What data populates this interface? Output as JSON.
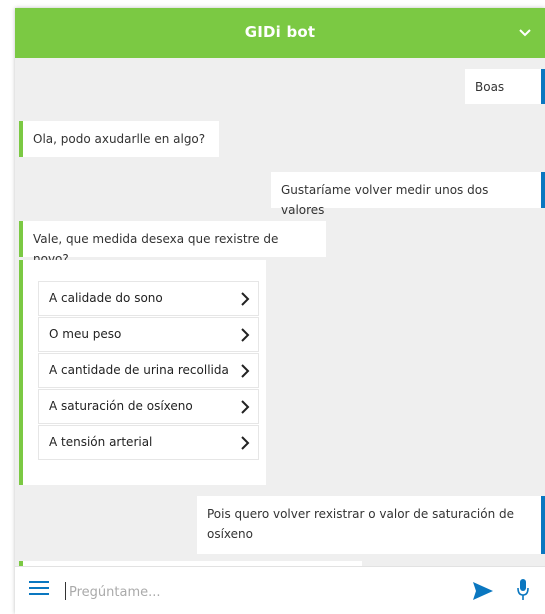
{
  "header": {
    "title": "GIDi bot"
  },
  "messages": [
    {
      "from": "user",
      "text": "Boas"
    },
    {
      "from": "bot",
      "text": "Ola, podo axudarlle en algo?"
    },
    {
      "from": "user",
      "text": "Gustaríame volver medir unos dos valores"
    },
    {
      "from": "bot",
      "text": "Vale, que medida desexa que rexistre de novo?"
    },
    {
      "from": "user",
      "text": "Pois quero volver rexistrar o valor de saturación de osíxeno"
    }
  ],
  "options": [
    {
      "label": "A calidade do sono"
    },
    {
      "label": "O meu peso"
    },
    {
      "label": "A cantidade de urina recollida"
    },
    {
      "label": "A saturación de osíxeno"
    },
    {
      "label": "A tensión arterial"
    }
  ],
  "input": {
    "placeholder": "Pregúntame...",
    "value": ""
  },
  "colors": {
    "brand_green": "#7bc943",
    "accent_blue": "#0a77c0"
  },
  "icons": [
    "chevron-down-icon",
    "chevron-right-icon",
    "menu-icon",
    "send-icon",
    "microphone-icon"
  ]
}
